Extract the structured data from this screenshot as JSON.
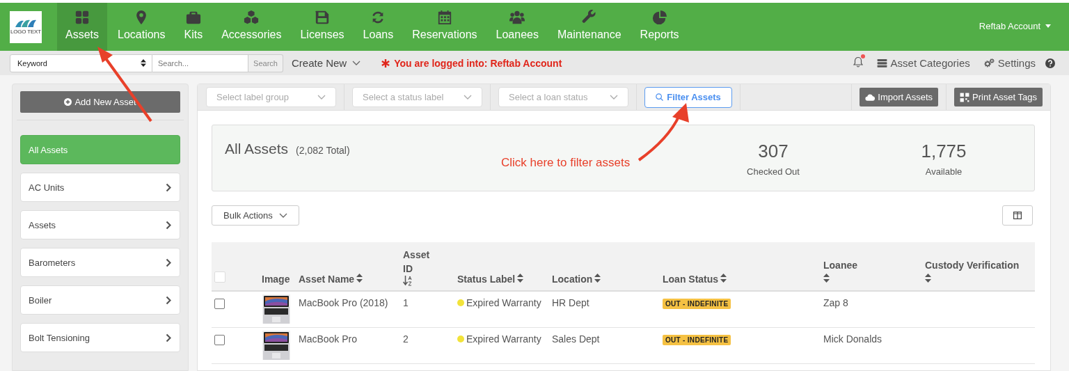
{
  "logo": {
    "text": "LOGO TEXT"
  },
  "nav": [
    {
      "label": "Assets",
      "selected": true
    },
    {
      "label": "Locations",
      "selected": false
    },
    {
      "label": "Kits",
      "selected": false
    },
    {
      "label": "Accessories",
      "selected": false
    },
    {
      "label": "Licenses",
      "selected": false
    },
    {
      "label": "Loans",
      "selected": false
    },
    {
      "label": "Reservations",
      "selected": false
    },
    {
      "label": "Loanees",
      "selected": false
    },
    {
      "label": "Maintenance",
      "selected": false
    },
    {
      "label": "Reports",
      "selected": false
    }
  ],
  "account_menu": {
    "label": "Reftab Account"
  },
  "toolbar": {
    "search_scope": "Keyword",
    "search_placeholder": "Search...",
    "search_button": "Search",
    "create_new": "Create New",
    "login_notice": "You are logged into: Reftab Account",
    "notifications": {
      "unread": true
    },
    "links": [
      {
        "label": "Asset Categories"
      },
      {
        "label": "Settings"
      }
    ]
  },
  "sidebar": {
    "add_button": "Add New Asset",
    "items": [
      {
        "label": "All Assets",
        "selected": true
      },
      {
        "label": "AC Units",
        "selected": false
      },
      {
        "label": "Assets",
        "selected": false
      },
      {
        "label": "Barometers",
        "selected": false
      },
      {
        "label": "Boiler",
        "selected": false
      },
      {
        "label": "Bolt Tensioning",
        "selected": false
      }
    ]
  },
  "filters": [
    {
      "placeholder": "Select label group"
    },
    {
      "placeholder": "Select a status label"
    },
    {
      "placeholder": "Select a loan status"
    }
  ],
  "filter_button": "Filter Assets",
  "actions": [
    {
      "label": "Import Assets"
    },
    {
      "label": "Print Asset Tags"
    }
  ],
  "summary": {
    "title": "All Assets",
    "total": "(2,082 Total)",
    "stats": [
      {
        "value": "307",
        "label": "Checked Out"
      },
      {
        "value": "1,775",
        "label": "Available"
      }
    ]
  },
  "bulk_actions": "Bulk Actions",
  "table": {
    "select_all": {
      "checked": false
    },
    "columns": [
      {
        "label": "Image",
        "kind": "plain"
      },
      {
        "label": "Asset Name",
        "kind": "sortable"
      },
      {
        "label": "Asset ID",
        "kind": "sorted"
      },
      {
        "label": "Status Label",
        "kind": "sortable"
      },
      {
        "label": "Location",
        "kind": "sortable"
      },
      {
        "label": "Loan Status",
        "kind": "sortable"
      },
      {
        "label": "Loanee",
        "kind": "sortable"
      },
      {
        "label": "Custody Verification",
        "kind": "sortable"
      }
    ],
    "rows": [
      {
        "checked": false,
        "name": "MacBook Pro (2018)",
        "id": "1",
        "status": {
          "label": "Expired Warranty",
          "color": "#f2e33a"
        },
        "location": "HR Dept",
        "loan_status": "OUT - INDEFINITE",
        "loanee": "Zap 8"
      },
      {
        "checked": false,
        "name": "MacBook Pro",
        "id": "2",
        "status": {
          "label": "Expired Warranty",
          "color": "#f2e33a"
        },
        "location": "Sales Dept",
        "loan_status": "OUT - INDEFINITE",
        "loanee": "Mick Donalds"
      }
    ]
  },
  "annotations": [
    {
      "text": "Click here to filter assets"
    }
  ]
}
